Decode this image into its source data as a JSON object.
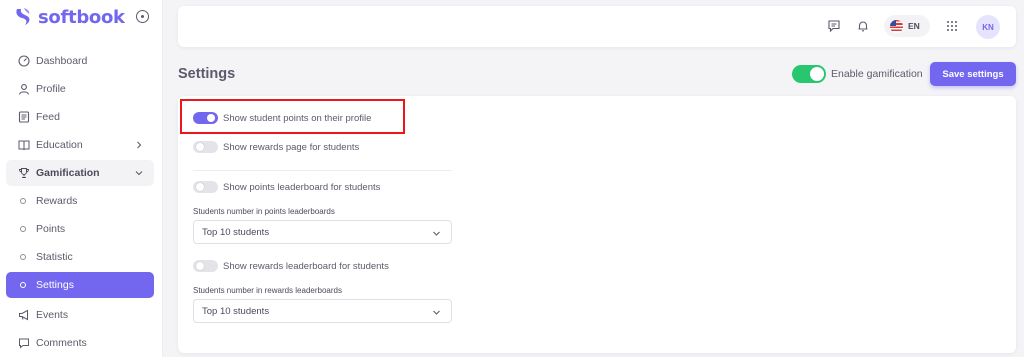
{
  "app": {
    "brand": "softbook"
  },
  "sidebar": {
    "items": [
      {
        "label": "Dashboard",
        "icon": "dashboard-icon"
      },
      {
        "label": "Profile",
        "icon": "user-icon"
      },
      {
        "label": "Feed",
        "icon": "feed-icon"
      },
      {
        "label": "Education",
        "icon": "book-icon"
      },
      {
        "label": "Gamification",
        "icon": "trophy-icon"
      },
      {
        "label": "Rewards"
      },
      {
        "label": "Points"
      },
      {
        "label": "Statistic"
      },
      {
        "label": "Settings"
      },
      {
        "label": "Events",
        "icon": "megaphone-icon"
      },
      {
        "label": "Comments",
        "icon": "comment-icon"
      }
    ]
  },
  "topbar": {
    "language": "EN",
    "avatar_initials": "KN"
  },
  "header": {
    "title": "Settings",
    "enable_gamification_label": "Enable gamification",
    "enable_gamification_on": true,
    "save_label": "Save settings"
  },
  "settings": {
    "show_points_profile": {
      "label": "Show student points on their profile",
      "on": true
    },
    "show_rewards_page": {
      "label": "Show rewards page for students",
      "on": false
    },
    "show_points_leaderboard": {
      "label": "Show points leaderboard for students",
      "on": false
    },
    "points_leaderboard_count": {
      "label": "Students number in points leaderboards",
      "value": "Top 10 students"
    },
    "show_rewards_leaderboard": {
      "label": "Show rewards leaderboard for students",
      "on": false
    },
    "rewards_leaderboard_count": {
      "label": "Students number in rewards leaderboards",
      "value": "Top 10 students"
    }
  },
  "colors": {
    "accent": "#7367f0",
    "success": "#28c76f",
    "highlight": "#e8181c"
  }
}
